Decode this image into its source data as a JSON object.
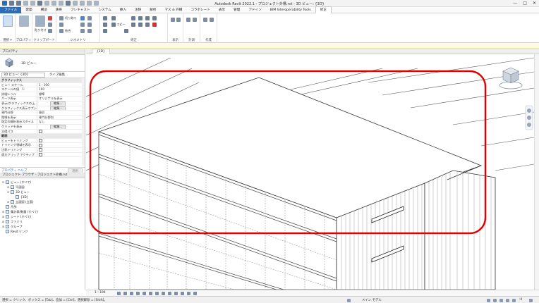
{
  "window": {
    "title": "Autodesk Revit 2022.1 - プロジェクト外構.rvt - 3D ビュー: {3D}",
    "controls": [
      "—",
      "□",
      "✕"
    ]
  },
  "menu": {
    "tabs": [
      "ファイル",
      "建築",
      "構造",
      "鉄骨",
      "プレキャスト",
      "システム",
      "挿入",
      "注釈",
      "解析",
      "マス & 外構",
      "コラボレート",
      "表示",
      "管理",
      "アドイン",
      "BIM Interoperability Tools",
      "修正"
    ],
    "active": "修正"
  },
  "ribbon": {
    "groups": {
      "select": "選択 ▾",
      "properties": "プロパティ",
      "clipboard": "クリップボード",
      "geometry": "ジオメトリ",
      "modify": "修正",
      "view": "表示",
      "measure": "計測",
      "create": "作成"
    },
    "small_labels": {
      "paste": "貼り付け",
      "cut": "切り取り",
      "join": "結合",
      "copy": "コピー"
    }
  },
  "properties": {
    "header": "プロパティ",
    "type_name": "3D ビュー",
    "selector": "3D ビュー: {3D}",
    "edit_type": "タイプ編集",
    "rows": [
      {
        "k": "グラフィックス",
        "v": "",
        "cat": true
      },
      {
        "k": "ビュー スケール",
        "v": "1 : 100"
      },
      {
        "k": "スケールの値　1:",
        "v": "100"
      },
      {
        "k": "詳細レベル",
        "v": "標準"
      },
      {
        "k": "パーツ表示",
        "v": "オリジナルを表示"
      },
      {
        "k": "表示/グラフィックスの上...",
        "v": "",
        "btn": "編集..."
      },
      {
        "k": "グラフィックス表示オプション",
        "v": "",
        "btn": "編集..."
      },
      {
        "k": "専門分野",
        "v": "意匠"
      },
      {
        "k": "隠線を表示",
        "v": "専門分野別"
      },
      {
        "k": "既定の解析表示スタイル",
        "v": "なし"
      },
      {
        "k": "グリッドを表示",
        "v": "",
        "btn": "編集..."
      },
      {
        "k": "太陽パス",
        "v": "",
        "cb": true
      },
      {
        "k": "範囲",
        "v": "",
        "cat": true
      },
      {
        "k": "ビューをトリミング",
        "v": "",
        "cb": true
      },
      {
        "k": "トリミング領域を表示",
        "v": "",
        "cb": true
      },
      {
        "k": "注釈トリミング",
        "v": "",
        "cb": true
      },
      {
        "k": "遠方クリップ アクティブ",
        "v": "",
        "cb": true
      }
    ],
    "help_link": "プロパティ ヘルプ",
    "apply": "適用"
  },
  "browser": {
    "header": "プロジェクト ブラウザ - プロジェクト外構.rvt",
    "items": [
      {
        "label": "ビュー (すべて)",
        "indent": 0,
        "exp": "⊟"
      },
      {
        "label": "平面図",
        "indent": 1,
        "exp": "⊞"
      },
      {
        "label": "3D ビュー",
        "indent": 1,
        "exp": "⊟"
      },
      {
        "label": "{3D}",
        "indent": 2,
        "exp": ""
      },
      {
        "label": "立面図 (立面)",
        "indent": 1,
        "exp": "⊞"
      },
      {
        "label": "凡例",
        "indent": 0,
        "exp": ""
      },
      {
        "label": "集計表/数量 (すべて)",
        "indent": 0,
        "exp": "⊞"
      },
      {
        "label": "シート (すべて)",
        "indent": 0,
        "exp": "⊞"
      },
      {
        "label": "ファミリ",
        "indent": 0,
        "exp": "⊞"
      },
      {
        "label": "グループ",
        "indent": 0,
        "exp": "⊞"
      },
      {
        "label": "Revit リンク",
        "indent": 0,
        "exp": ""
      }
    ]
  },
  "viewport": {
    "tab_label": "{3D}",
    "scale": "1 : 100",
    "highlight_color": "#e00000"
  },
  "status": {
    "message": "選択 = クリック、ボックス = [Tab]、追加 = [Ctrl]、選択解除 = [Shift]。",
    "model": "メイン モデル",
    "zero": ":0"
  }
}
